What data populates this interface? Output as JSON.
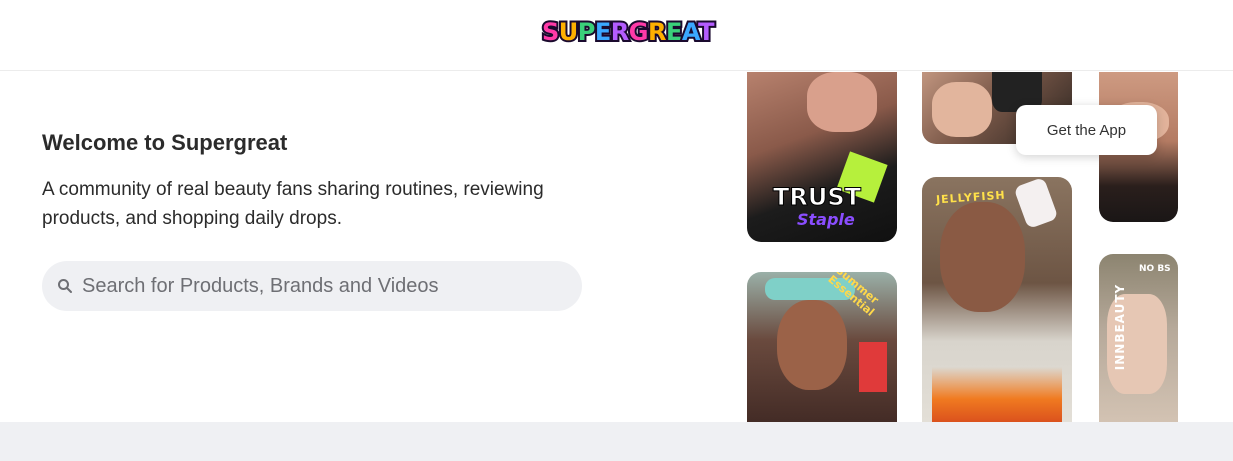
{
  "header": {
    "logo_text": "SUPERGREAT",
    "logo_colors": [
      "#ff3aa8",
      "#ffb000",
      "#3ad07a",
      "#3aa7ff",
      "#b45cff"
    ]
  },
  "hero": {
    "title": "Welcome to Supergreat",
    "subtitle": "A community of real beauty fans sharing routines, reviewing products, and shopping daily drops.",
    "search": {
      "placeholder": "Search for Products, Brands and Videos",
      "value": "",
      "icon": "search-icon"
    },
    "get_app_label": "Get the App",
    "video_cards": [
      {
        "caption_main": "TRUST",
        "caption_sub": "Staple"
      },
      {
        "caption_main": ""
      },
      {
        "caption_main": ""
      },
      {
        "caption_main": "Summer Essential"
      },
      {
        "caption_main": "JELLYFISH"
      },
      {
        "caption_main": "INNBEAUTY",
        "caption_sub": "NO BS"
      }
    ]
  },
  "colors": {
    "text": "#2b2b2b",
    "search_bg": "#eff0f3",
    "footer_bg": "#eff0f3",
    "accent_purple": "#7a3cff"
  }
}
